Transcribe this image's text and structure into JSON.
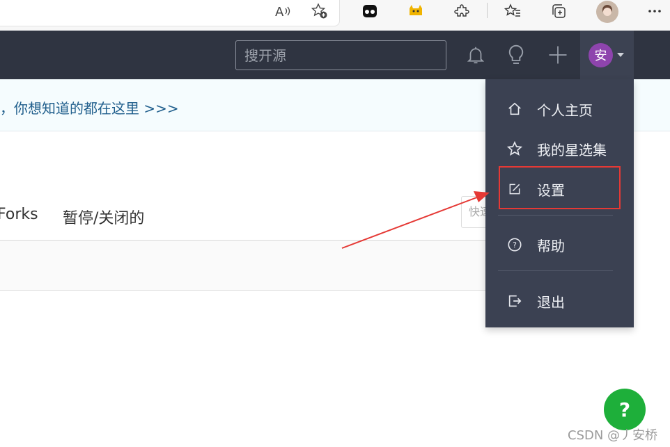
{
  "browser": {
    "icons": [
      "read-aloud-icon",
      "add-favorite-icon",
      "extension-bot-icon",
      "extension-cat-icon",
      "extensions-icon",
      "favorites-icon",
      "collections-icon",
      "profile-icon",
      "more-icon"
    ]
  },
  "navbar": {
    "search_placeholder": "搜开源",
    "icons": [
      "bell-icon",
      "lightbulb-icon",
      "plus-icon"
    ],
    "avatar_text": "安",
    "avatar_color": "#8e44ad"
  },
  "notice": {
    "text": "，你想知道的都在这里 >>>"
  },
  "tabs": [
    "Forks",
    "暂停/关闭的"
  ],
  "quick_search_placeholder": "快速",
  "user_menu": {
    "items": [
      {
        "label": "个人主页",
        "icon": "home-icon"
      },
      {
        "label": "我的星选集",
        "icon": "star-icon"
      },
      {
        "label": "设置",
        "icon": "edit-icon"
      },
      {
        "label": "帮助",
        "icon": "help-circle-icon"
      },
      {
        "label": "退出",
        "icon": "logout-icon"
      }
    ]
  },
  "help_button": {
    "label": "?"
  },
  "watermark": "CSDN @丿安桥",
  "colors": {
    "navbar": "#2f3441",
    "menu": "#3b4152",
    "highlight": "#e53935",
    "help": "#1eaf3a"
  }
}
